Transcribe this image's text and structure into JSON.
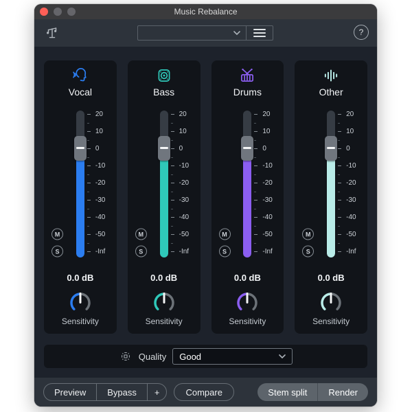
{
  "window": {
    "title": "Music Rebalance"
  },
  "toolbar": {
    "preset_value": "",
    "help_label": "?"
  },
  "fader": {
    "scale_labels": [
      "20",
      "10",
      "0",
      "-10",
      "-20",
      "-30",
      "-40",
      "-50",
      "-Inf"
    ],
    "mute_label": "M",
    "solo_label": "S"
  },
  "channels": [
    {
      "name": "Vocal",
      "icon": "vocal",
      "color": "#2b7df0",
      "value": "0.0 dB",
      "knob_label": "Sensitivity"
    },
    {
      "name": "Bass",
      "icon": "bass",
      "color": "#2fc8b9",
      "value": "0.0 dB",
      "knob_label": "Sensitivity"
    },
    {
      "name": "Drums",
      "icon": "drums",
      "color": "#8b5ef0",
      "value": "0.0 dB",
      "knob_label": "Sensitivity"
    },
    {
      "name": "Other",
      "icon": "other",
      "color": "#b9ece8",
      "value": "0.0 dB",
      "knob_label": "Sensitivity"
    }
  ],
  "quality": {
    "label": "Quality",
    "value": "Good"
  },
  "footer": {
    "preview": "Preview",
    "bypass": "Bypass",
    "add": "+",
    "compare": "Compare",
    "stem_split": "Stem split",
    "render": "Render"
  }
}
